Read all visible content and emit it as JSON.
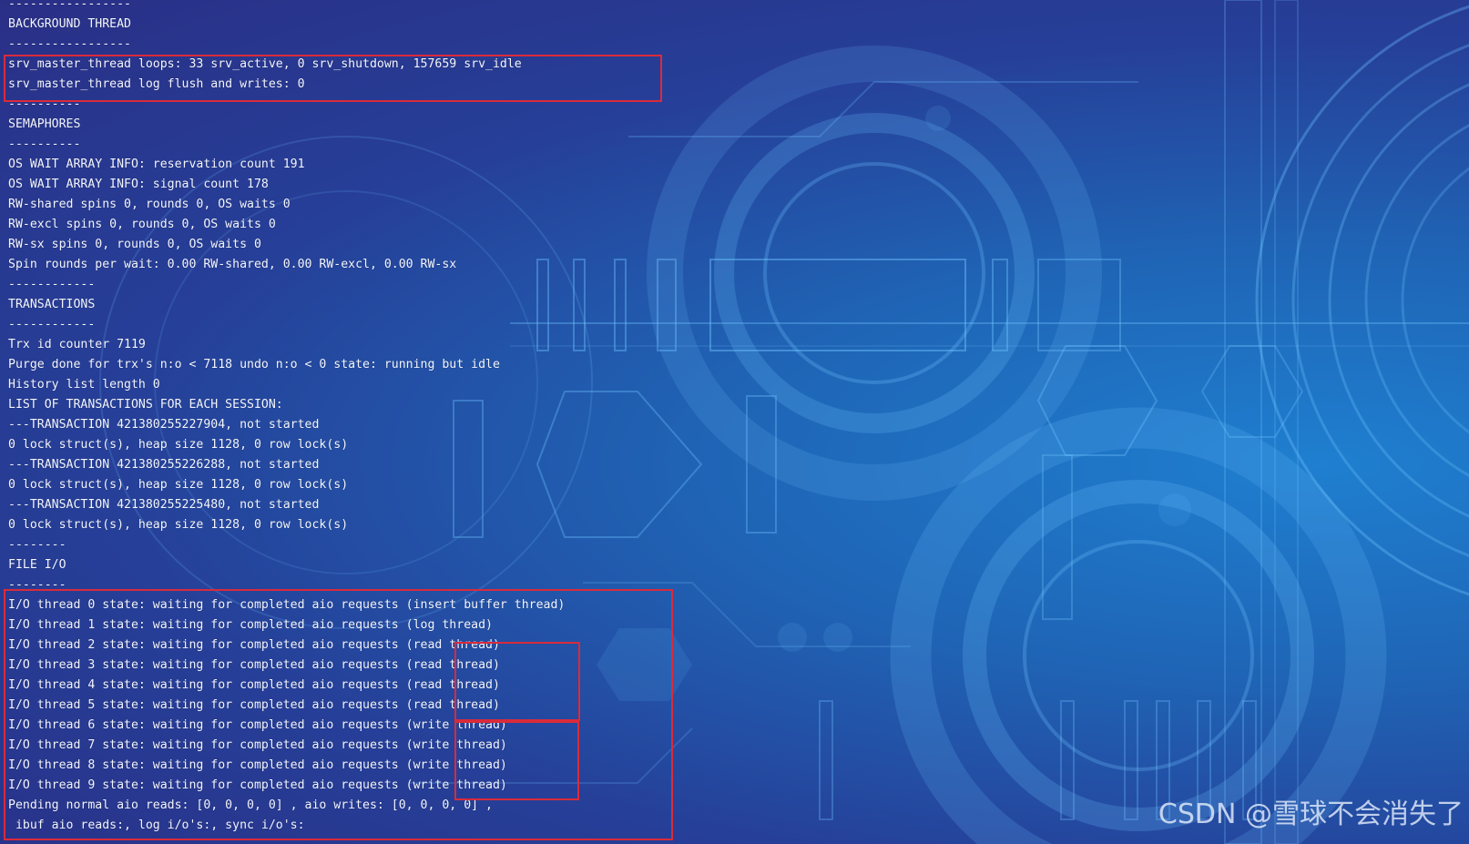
{
  "terminal": {
    "lines": [
      "-----------------",
      "BACKGROUND THREAD",
      "-----------------",
      "srv_master_thread loops: 33 srv_active, 0 srv_shutdown, 157659 srv_idle",
      "srv_master_thread log flush and writes: 0",
      "----------",
      "SEMAPHORES",
      "----------",
      "OS WAIT ARRAY INFO: reservation count 191",
      "OS WAIT ARRAY INFO: signal count 178",
      "RW-shared spins 0, rounds 0, OS waits 0",
      "RW-excl spins 0, rounds 0, OS waits 0",
      "RW-sx spins 0, rounds 0, OS waits 0",
      "Spin rounds per wait: 0.00 RW-shared, 0.00 RW-excl, 0.00 RW-sx",
      "------------",
      "TRANSACTIONS",
      "------------",
      "Trx id counter 7119",
      "Purge done for trx's n:o < 7118 undo n:o < 0 state: running but idle",
      "History list length 0",
      "LIST OF TRANSACTIONS FOR EACH SESSION:",
      "---TRANSACTION 421380255227904, not started",
      "0 lock struct(s), heap size 1128, 0 row lock(s)",
      "---TRANSACTION 421380255226288, not started",
      "0 lock struct(s), heap size 1128, 0 row lock(s)",
      "---TRANSACTION 421380255225480, not started",
      "0 lock struct(s), heap size 1128, 0 row lock(s)",
      "--------",
      "FILE I/O",
      "--------",
      "I/O thread 0 state: waiting for completed aio requests (insert buffer thread)",
      "I/O thread 1 state: waiting for completed aio requests (log thread)",
      "I/O thread 2 state: waiting for completed aio requests (read thread)",
      "I/O thread 3 state: waiting for completed aio requests (read thread)",
      "I/O thread 4 state: waiting for completed aio requests (read thread)",
      "I/O thread 5 state: waiting for completed aio requests (read thread)",
      "I/O thread 6 state: waiting for completed aio requests (write thread)",
      "I/O thread 7 state: waiting for completed aio requests (write thread)",
      "I/O thread 8 state: waiting for completed aio requests (write thread)",
      "I/O thread 9 state: waiting for completed aio requests (write thread)",
      "Pending normal aio reads: [0, 0, 0, 0] , aio writes: [0, 0, 0, 0] ,",
      " ibuf aio reads:, log i/o's:, sync i/o's:"
    ]
  },
  "highlights": [
    {
      "name": "background-thread-highlight",
      "color": "#d92b3b"
    },
    {
      "name": "file-io-highlight",
      "color": "#d92b3b"
    },
    {
      "name": "read-thread-highlight",
      "color": "#d92b3b"
    },
    {
      "name": "write-thread-highlight",
      "color": "#d92b3b"
    }
  ],
  "watermark": {
    "text": "CSDN @雪球不会消失了"
  },
  "colors": {
    "background_dark": "#2a2f86",
    "background_light": "#1f7fd0",
    "text": "#f3f6ff",
    "highlight": "#d92b3b"
  }
}
